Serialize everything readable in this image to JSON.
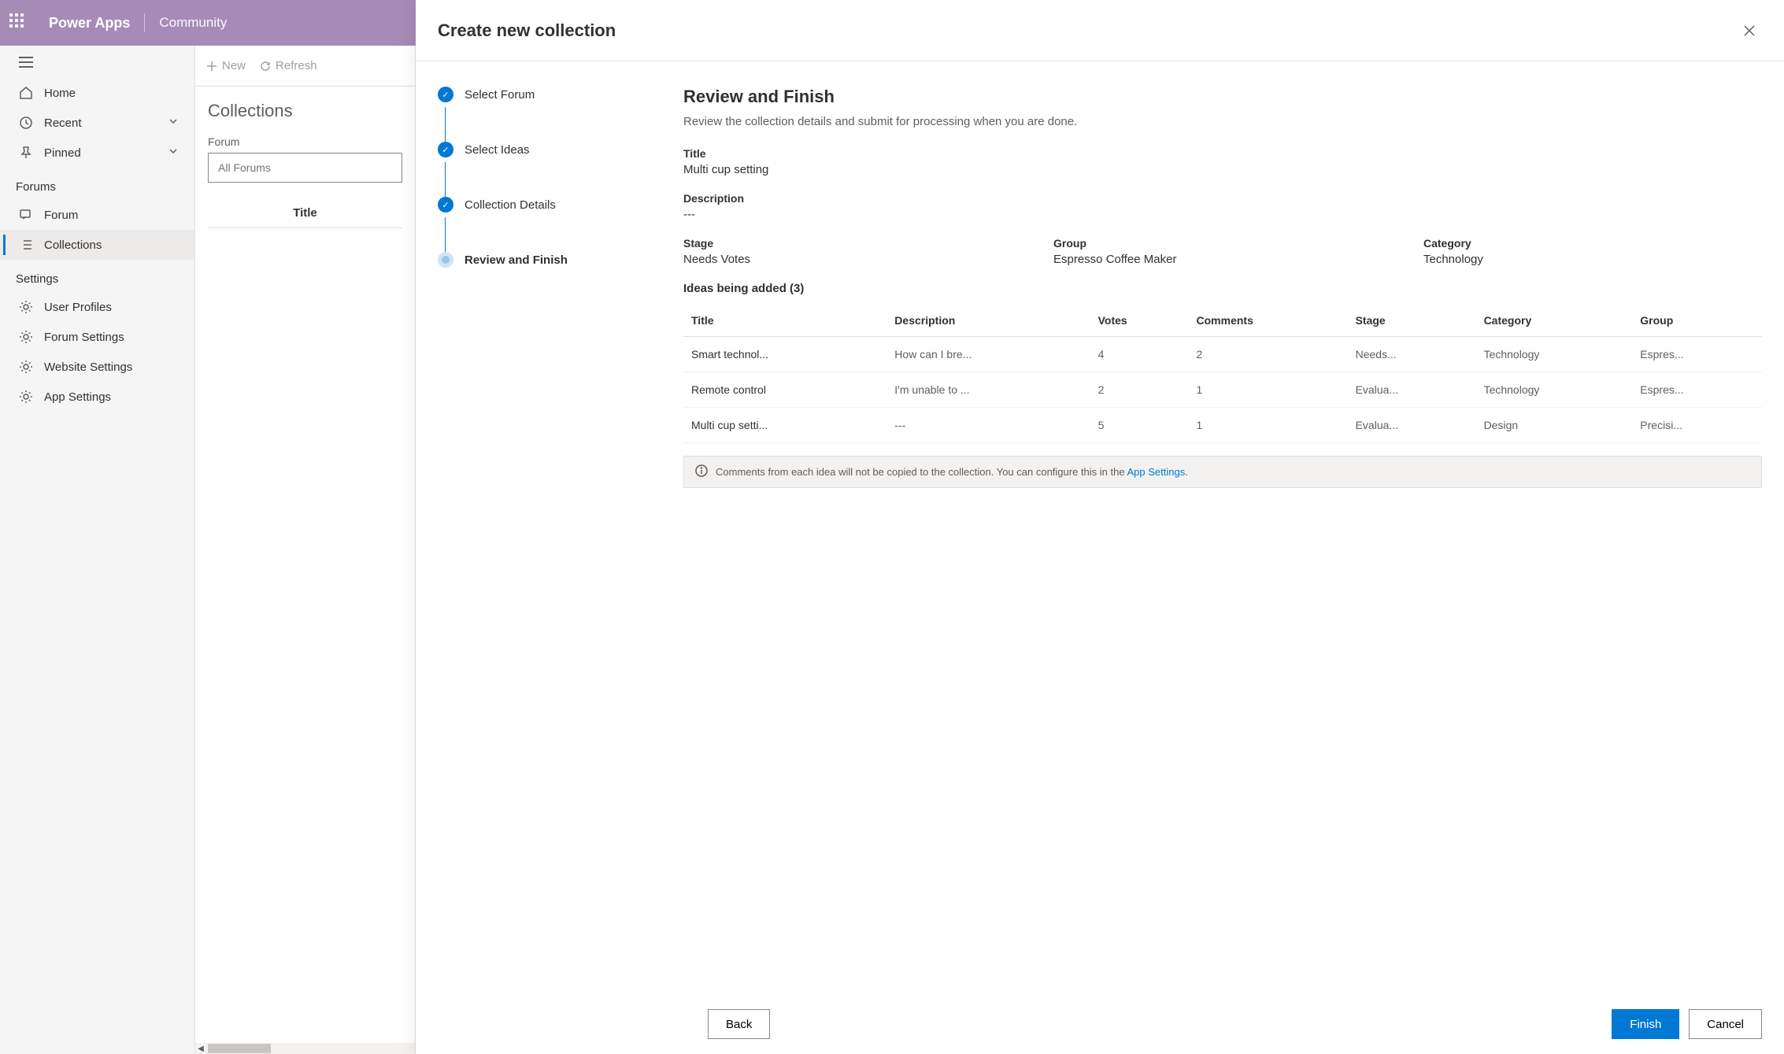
{
  "header": {
    "app": "Power Apps",
    "section": "Community"
  },
  "sidebar": {
    "items": [
      {
        "label": "Home"
      },
      {
        "label": "Recent"
      },
      {
        "label": "Pinned"
      }
    ],
    "forums_header": "Forums",
    "forum_label": "Forum",
    "collections_label": "Collections",
    "settings_header": "Settings",
    "settings": [
      {
        "label": "User Profiles"
      },
      {
        "label": "Forum Settings"
      },
      {
        "label": "Website Settings"
      },
      {
        "label": "App Settings"
      }
    ]
  },
  "midcol": {
    "new_label": "New",
    "refresh_label": "Refresh",
    "title": "Collections",
    "forum_label": "Forum",
    "forum_placeholder": "All Forums",
    "col_title": "Title"
  },
  "modal": {
    "title": "Create new collection",
    "steps": [
      {
        "label": "Select Forum",
        "state": "done"
      },
      {
        "label": "Select Ideas",
        "state": "done"
      },
      {
        "label": "Collection Details",
        "state": "done"
      },
      {
        "label": "Review and Finish",
        "state": "current"
      }
    ],
    "review": {
      "heading": "Review and Finish",
      "sub": "Review the collection details and submit for processing when you are done.",
      "title_label": "Title",
      "title_value": "Multi cup setting",
      "desc_label": "Description",
      "desc_value": "---",
      "stage_label": "Stage",
      "stage_value": "Needs Votes",
      "group_label": "Group",
      "group_value": "Espresso Coffee Maker",
      "category_label": "Category",
      "category_value": "Technology",
      "ideas_label": "Ideas being added (3)",
      "columns": [
        "Title",
        "Description",
        "Votes",
        "Comments",
        "Stage",
        "Category",
        "Group"
      ],
      "rows": [
        {
          "title": "Smart technol...",
          "desc": "How can I bre...",
          "votes": "4",
          "comments": "2",
          "stage": "Needs...",
          "category": "Technology",
          "group": "Espres..."
        },
        {
          "title": "Remote control",
          "desc": "I'm unable to ...",
          "votes": "2",
          "comments": "1",
          "stage": "Evalua...",
          "category": "Technology",
          "group": "Espres..."
        },
        {
          "title": "Multi cup setti...",
          "desc": "---",
          "votes": "5",
          "comments": "1",
          "stage": "Evalua...",
          "category": "Design",
          "group": "Precisi..."
        }
      ],
      "banner_text": "Comments from each idea will not be copied to the collection. You can configure this in the ",
      "banner_link": "App Settings"
    },
    "footer": {
      "back": "Back",
      "finish": "Finish",
      "cancel": "Cancel"
    }
  }
}
